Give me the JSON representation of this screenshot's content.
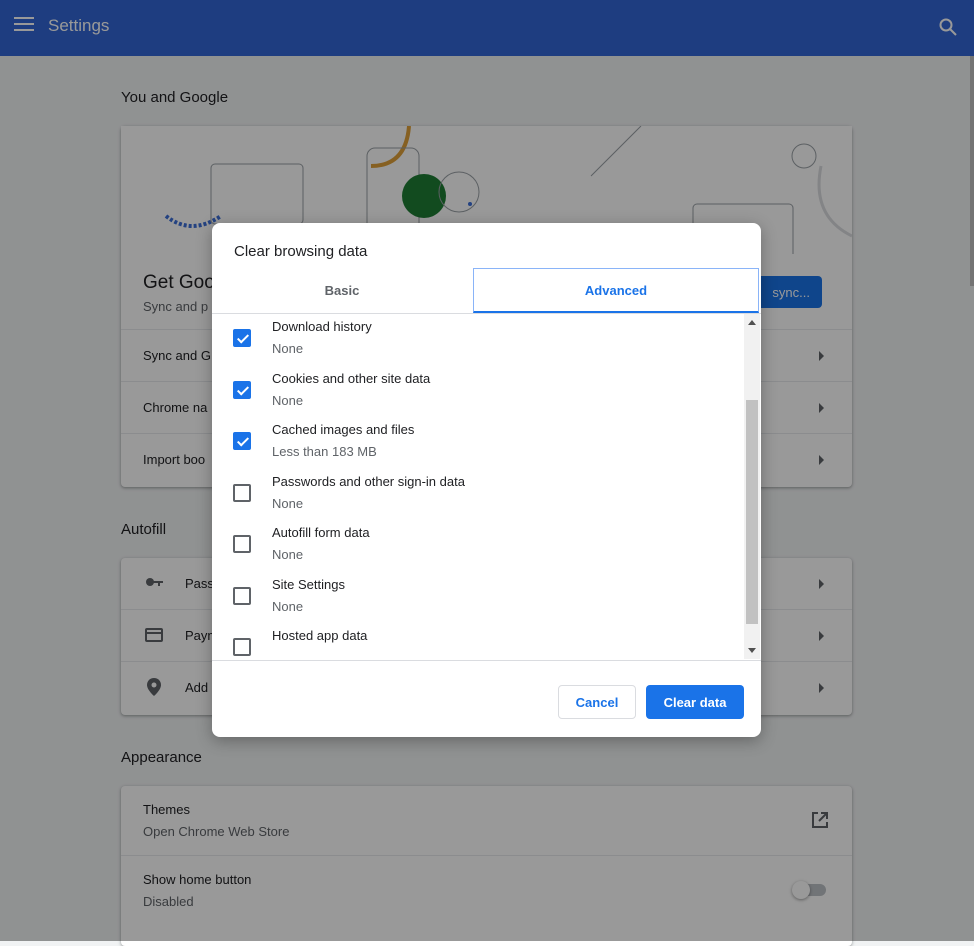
{
  "topbar": {
    "title": "Settings"
  },
  "sections": {
    "you_and_google": {
      "title": "You and Google",
      "get_google": "Get Goo",
      "sync_sub": "Sync and p",
      "sync_button": "sync...",
      "rows": [
        "Sync and G",
        "Chrome na",
        "Import boo"
      ]
    },
    "autofill": {
      "title": "Autofill",
      "rows": [
        "Pass",
        "Paym",
        "Add"
      ]
    },
    "appearance": {
      "title": "Appearance",
      "themes": {
        "label": "Themes",
        "sub": "Open Chrome Web Store"
      },
      "home_button": {
        "label": "Show home button",
        "sub": "Disabled"
      }
    }
  },
  "dialog": {
    "title": "Clear browsing data",
    "tabs": {
      "basic": "Basic",
      "advanced": "Advanced"
    },
    "items": [
      {
        "label": "Download history",
        "value": "None",
        "checked": true
      },
      {
        "label": "Cookies and other site data",
        "value": "None",
        "checked": true
      },
      {
        "label": "Cached images and files",
        "value": "Less than 183 MB",
        "checked": true
      },
      {
        "label": "Passwords and other sign-in data",
        "value": "None",
        "checked": false
      },
      {
        "label": "Autofill form data",
        "value": "None",
        "checked": false
      },
      {
        "label": "Site Settings",
        "value": "None",
        "checked": false
      },
      {
        "label": "Hosted app data",
        "value": "",
        "checked": false
      }
    ],
    "cancel": "Cancel",
    "clear": "Clear data"
  },
  "colors": {
    "accent": "#1a73e8",
    "topbar": "#3367d6"
  }
}
